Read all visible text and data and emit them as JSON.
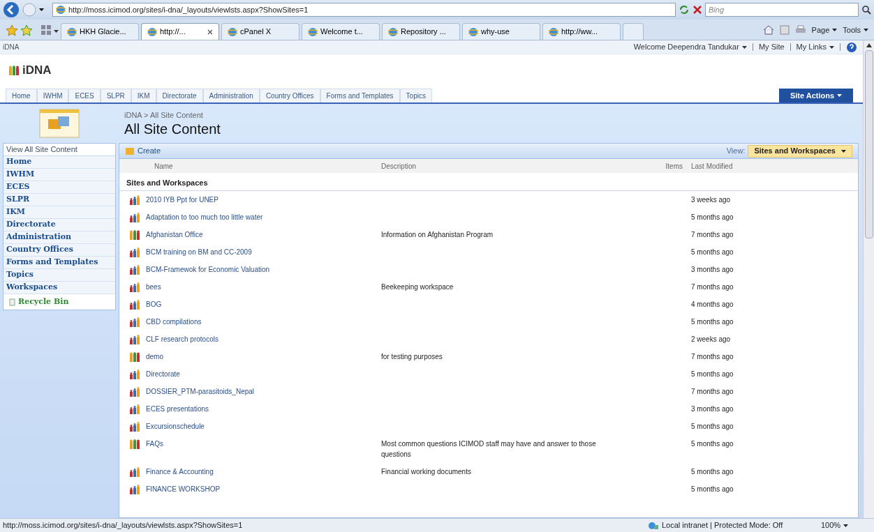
{
  "browser": {
    "address": "http://moss.icimod.org/sites/i-dna/_layouts/viewlsts.aspx?ShowSites=1",
    "search_placeholder": "Bing",
    "tabs": [
      {
        "label": "HKH Glacie...",
        "selected": false,
        "closable": false
      },
      {
        "label": "http://...",
        "selected": true,
        "closable": true
      },
      {
        "label": "cPanel X",
        "selected": false,
        "closable": false
      },
      {
        "label": "Welcome t...",
        "selected": false,
        "closable": false
      },
      {
        "label": "Repository ...",
        "selected": false,
        "closable": false
      },
      {
        "label": "why-use",
        "selected": false,
        "closable": false
      },
      {
        "label": "http://ww...",
        "selected": false,
        "closable": false
      }
    ],
    "commands": [
      {
        "label": "Page"
      },
      {
        "label": "Tools"
      }
    ]
  },
  "page": {
    "site_name": "iDNA",
    "brand": "iDNA",
    "welcome": "Welcome Deependra Tandukar",
    "my_site": "My Site",
    "my_links": "My Links",
    "nav_tabs": [
      "Home",
      "IWHM",
      "ECES",
      "SLPR",
      "IKM",
      "Directorate",
      "Administration",
      "Country Offices",
      "Forms and Templates",
      "Topics"
    ],
    "site_actions": "Site Actions",
    "breadcrumb": "iDNA > All Site Content",
    "title": "All Site Content",
    "quick_launch": {
      "header": "View All Site Content",
      "items": [
        "Home",
        "IWHM",
        "ECES",
        "SLPR",
        "IKM",
        "Directorate",
        "Administration",
        "Country Offices",
        "Forms and Templates",
        "Topics",
        "Workspaces"
      ],
      "recycle_bin": "Recycle Bin"
    },
    "toolbar": {
      "create": "Create",
      "view_label": "View:",
      "view": "Sites and Workspaces"
    },
    "columns": [
      "Name",
      "Description",
      "Items",
      "Last Modified"
    ],
    "group": "Sites and Workspaces",
    "rows": [
      {
        "kind": "workspace",
        "name": "2010 IYB Ppt for UNEP",
        "description": "",
        "modified": "3 weeks ago"
      },
      {
        "kind": "workspace",
        "name": "Adaptation to too much too little water",
        "description": "",
        "modified": "5 months ago"
      },
      {
        "kind": "site",
        "name": "Afghanistan Office",
        "description": "Information on Afghanistan Program",
        "modified": "7 months ago"
      },
      {
        "kind": "workspace",
        "name": "BCM training on BM and CC-2009",
        "description": "",
        "modified": "5 months ago"
      },
      {
        "kind": "workspace",
        "name": "BCM-Framewok for Economic Valuation",
        "description": "",
        "modified": "3 months ago"
      },
      {
        "kind": "workspace",
        "name": "bees",
        "description": "Beekeeping workspace",
        "modified": "7 months ago"
      },
      {
        "kind": "workspace",
        "name": "BOG",
        "description": "",
        "modified": "4 months ago"
      },
      {
        "kind": "workspace",
        "name": "CBD compilations",
        "description": "",
        "modified": "5 months ago"
      },
      {
        "kind": "workspace",
        "name": "CLF research protocols",
        "description": "",
        "modified": "2 weeks ago"
      },
      {
        "kind": "site",
        "name": "demo",
        "description": "for testing purposes",
        "modified": "7 months ago"
      },
      {
        "kind": "workspace",
        "name": "Directorate",
        "description": "",
        "modified": "5 months ago"
      },
      {
        "kind": "workspace",
        "name": "DOSSIER_PTM-parasitoids_Nepal",
        "description": "",
        "modified": "7 months ago"
      },
      {
        "kind": "workspace",
        "name": "ECES presentations",
        "description": "",
        "modified": "3 months ago"
      },
      {
        "kind": "workspace",
        "name": "Excursionschedule",
        "description": "",
        "modified": "5 months ago"
      },
      {
        "kind": "site",
        "name": "FAQs",
        "description": "Most common questions ICIMOD staff may have and answer to those questions",
        "modified": "5 months ago"
      },
      {
        "kind": "workspace",
        "name": "Finance & Accounting",
        "description": "Financial working documents",
        "modified": "5 months ago"
      },
      {
        "kind": "workspace",
        "name": "FINANCE WORKSHOP",
        "description": "",
        "modified": "5 months ago"
      }
    ]
  },
  "status_bar": {
    "url": "http://moss.icimod.org/sites/i-dna/_layouts/viewlsts.aspx?ShowSites=1",
    "zone": "Local intranet | Protected Mode: Off",
    "zoom": "100%"
  }
}
